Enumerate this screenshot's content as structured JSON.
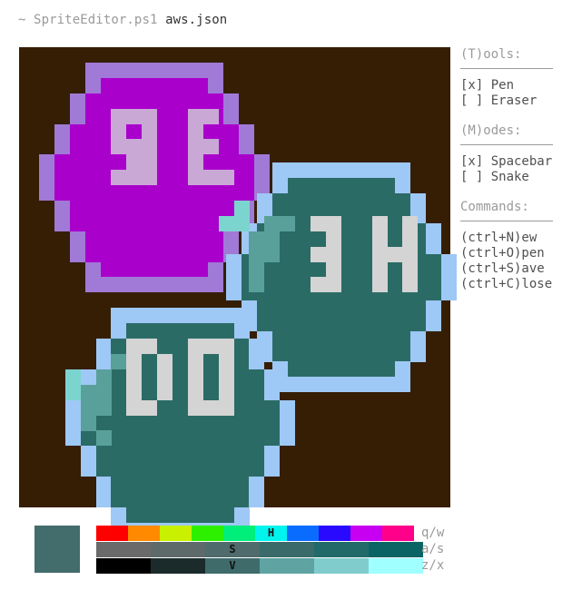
{
  "titlebar": {
    "prompt": "~ SpriteEditor.ps1",
    "filename": "aws.json"
  },
  "tools": {
    "title": "(T)ools:",
    "items": [
      {
        "label": "[x] Pen"
      },
      {
        "label": "[ ] Eraser"
      }
    ]
  },
  "modes": {
    "title": "(M)odes:",
    "items": [
      {
        "label": "[x] Spacebar"
      },
      {
        "label": "[ ] Snake"
      }
    ]
  },
  "commands": {
    "title": "Commands:",
    "items": [
      {
        "label": "(ctrl+N)ew"
      },
      {
        "label": "(ctrl+O)pen"
      },
      {
        "label": "(ctrl+S)ave"
      },
      {
        "label": "(ctrl+C)lose"
      }
    ]
  },
  "current_color": "#436c6c",
  "canvas_background": "#361e04",
  "palette": {
    "rows": [
      {
        "key": "q/w",
        "swatches": [
          {
            "color": "#ff0000",
            "label": ""
          },
          {
            "color": "#ff8a00",
            "label": ""
          },
          {
            "color": "#c8f000",
            "label": ""
          },
          {
            "color": "#2cf000",
            "label": ""
          },
          {
            "color": "#00ee7a",
            "label": ""
          },
          {
            "color": "#00f4ee",
            "label": "H"
          },
          {
            "color": "#0a6cff",
            "label": ""
          },
          {
            "color": "#2a0aff",
            "label": ""
          },
          {
            "color": "#c800f2",
            "label": ""
          },
          {
            "color": "#ff008a",
            "label": ""
          }
        ]
      },
      {
        "key": "a/s",
        "swatches": [
          {
            "color": "#6a6a6a",
            "label": ""
          },
          {
            "color": "#5e6a6a",
            "label": ""
          },
          {
            "color": "#4f6b6b",
            "label": "S"
          },
          {
            "color": "#3a6a6a",
            "label": ""
          },
          {
            "color": "#226a6a",
            "label": ""
          },
          {
            "color": "#0b6464",
            "label": ""
          }
        ]
      },
      {
        "key": "z/x",
        "swatches": [
          {
            "color": "#000000",
            "label": ""
          },
          {
            "color": "#1b2b2b",
            "label": ""
          },
          {
            "color": "#3f6b6b",
            "label": "V"
          },
          {
            "color": "#5fa3a3",
            "label": ""
          },
          {
            "color": "#80cccc",
            "label": ""
          },
          {
            "color": "#a0ffff",
            "label": ""
          }
        ]
      }
    ]
  },
  "sprite": {
    "colors": {
      "magenta": "#aa00cc",
      "magenta_light": "#c9a8d6",
      "magenta_mid": "#c07ad6",
      "purple_border": "#a07ad6",
      "purple_dark": "#5b3a6e",
      "teal_dark": "#2b6b66",
      "teal_mid": "#5aa09a",
      "teal_light": "#7cd4cf",
      "cyan_border": "#9ec8f5",
      "blue_border": "#3f6bb3",
      "letter_gray": "#d4d4d4",
      "slate": "#5a7aa0"
    },
    "shapes": [
      {
        "kind": "hex",
        "rx": 9,
        "ry": 4,
        "w": 16,
        "h": 14,
        "fill": "magenta",
        "border": "purple_border"
      },
      {
        "kind": "hex",
        "rx": 20,
        "ry": 12,
        "w": 14,
        "h": 15,
        "fill": "teal_dark",
        "border": "cyan_border"
      },
      {
        "kind": "hex",
        "rx": 5,
        "ry": 22,
        "w": 15,
        "h": 15,
        "fill": "teal_dark",
        "border": "cyan_border"
      }
    ]
  }
}
